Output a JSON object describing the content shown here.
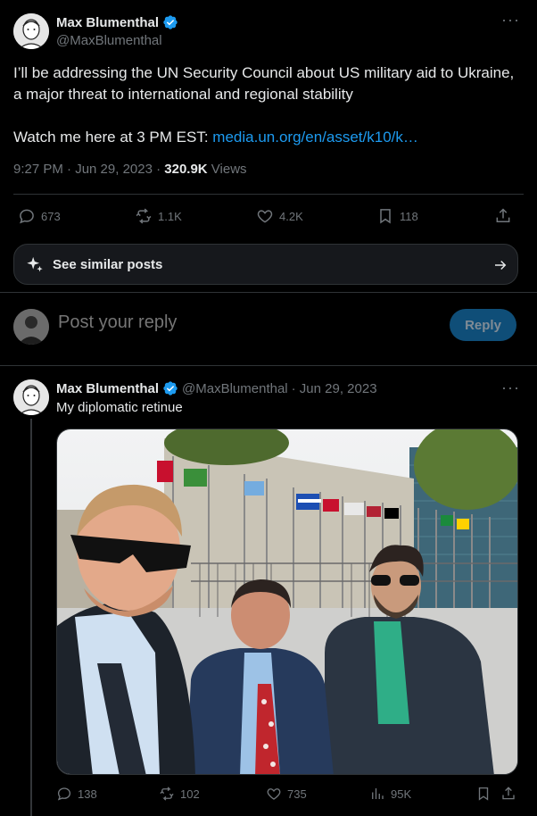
{
  "main_tweet": {
    "display_name": "Max Blumenthal",
    "handle": "@MaxBlumenthal",
    "text_line1": "I’ll be addressing the UN Security Council about US military aid to Ukraine, a major threat to international and regional stability",
    "text_watch": "Watch me here at 3 PM EST: ",
    "link_text": "media.un.org/en/asset/k10/k…",
    "time": "9:27 PM · Jun 29, 2023 · ",
    "views_count": "320.9K",
    "views_label": " Views",
    "stats": {
      "replies": "673",
      "retweets": "1.1K",
      "likes": "4.2K",
      "bookmarks": "118"
    }
  },
  "see_similar": {
    "label": "See similar posts"
  },
  "reply_box": {
    "placeholder": "Post your reply",
    "button": "Reply"
  },
  "reply_tweet": {
    "display_name": "Max Blumenthal",
    "handle": "@MaxBlumenthal",
    "date": " · Jun 29, 2023",
    "text": "My diplomatic retinue",
    "stats": {
      "replies": "138",
      "retweets": "102",
      "likes": "735",
      "views": "95K"
    }
  },
  "colors": {
    "background": "#000000",
    "accent": "#1d9bf0",
    "muted": "#71767b",
    "text": "#e7e9ea"
  },
  "icons": [
    "more-icon",
    "verified-icon",
    "reply-icon",
    "retweet-icon",
    "like-icon",
    "bookmark-icon",
    "share-icon",
    "sparkle-icon",
    "arrow-right-icon",
    "views-icon"
  ]
}
